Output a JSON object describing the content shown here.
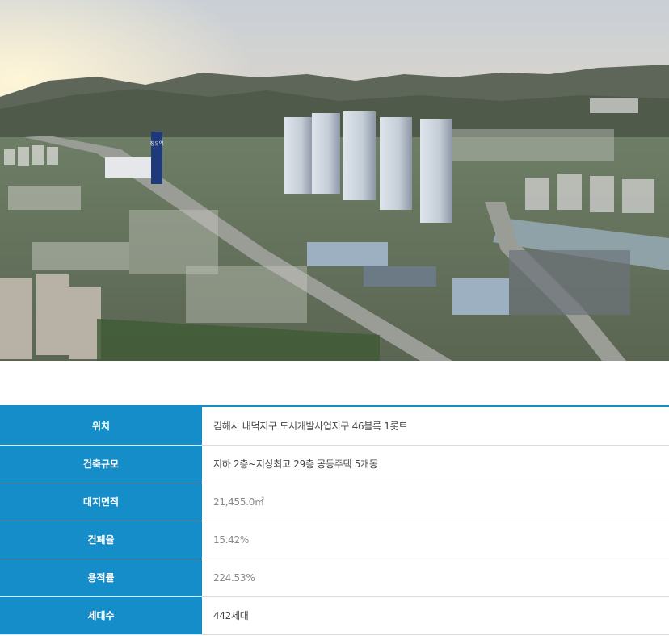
{
  "hero": {
    "tower_sign": "장유역",
    "image_alt": "aerial rendering of apartment complex"
  },
  "spec_table": {
    "rows": [
      {
        "label": "위치",
        "value": "김해시 내덕지구 도시개발사업지구 46블록 1롯트"
      },
      {
        "label": "건축규모",
        "value": "지하 2층~지상최고 29층 공동주택 5개동"
      },
      {
        "label": "대지면적",
        "value": "21,455.0㎡"
      },
      {
        "label": "건폐율",
        "value": "15.42%"
      },
      {
        "label": "용적률",
        "value": "224.53%"
      },
      {
        "label": "세대수",
        "value": "442세대"
      }
    ]
  },
  "colors": {
    "header_cell": "#148dc8",
    "border": "#dcdcdc"
  }
}
